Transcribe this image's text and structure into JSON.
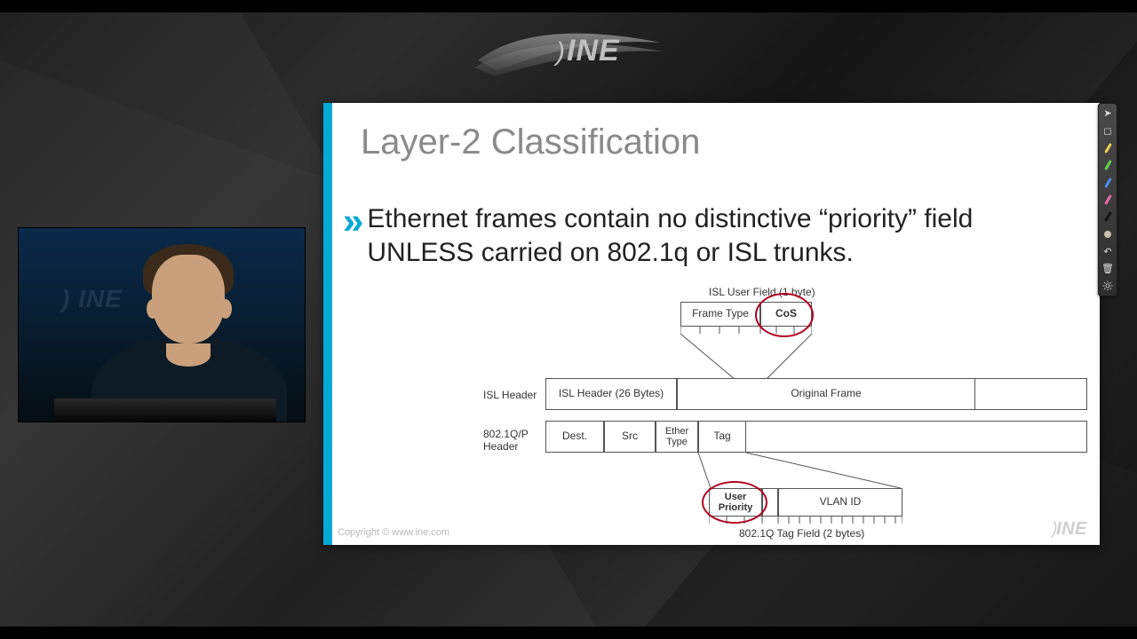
{
  "brand": {
    "name": "INE"
  },
  "slide": {
    "title": "Layer-2 Classification",
    "bullet": "Ethernet frames contain no distinctive “priority” field UNLESS carried on 802.1q or ISL trunks.",
    "copyright": "Copyright © www.ine.com",
    "logo": "INE"
  },
  "diagram": {
    "isl_user_field_label": "ISL User Field (1 byte)",
    "frame_type": "Frame Type",
    "cos": "CoS",
    "isl_header_label": "ISL Header",
    "isl_header_box": "ISL Header (26 Bytes)",
    "original_frame": "Original Frame",
    "dot1q_header_label": "802.1Q/P Header",
    "dest": "Dest.",
    "src": "Src",
    "ether_type": "Ether Type",
    "tag": "Tag",
    "user_priority": "User Priority",
    "vlan_id": "VLAN ID",
    "tag_field_label": "802.1Q Tag Field (2 bytes)"
  },
  "toolbar": {
    "items": [
      {
        "name": "pointer-icon",
        "color": "#d0d0d0"
      },
      {
        "name": "select-icon",
        "color": "#d0d0d0"
      },
      {
        "name": "pen-yellow-icon",
        "color": "#e8d24a"
      },
      {
        "name": "pen-green-icon",
        "color": "#63d24a"
      },
      {
        "name": "pen-blue-icon",
        "color": "#4a8fe8"
      },
      {
        "name": "pen-pink-icon",
        "color": "#e86aa8"
      },
      {
        "name": "pen-black-icon",
        "color": "#1a1a1a"
      },
      {
        "name": "eraser-icon",
        "color": "#c7bfae"
      },
      {
        "name": "undo-icon",
        "color": "#bdbdbd"
      },
      {
        "name": "trash-icon",
        "color": "#bdbdbd"
      },
      {
        "name": "settings-icon",
        "color": "#bdbdbd"
      }
    ]
  }
}
